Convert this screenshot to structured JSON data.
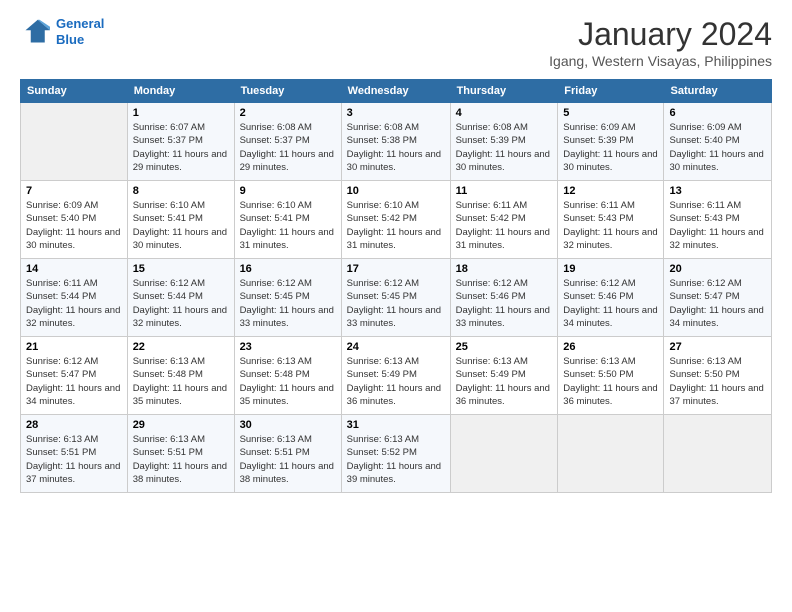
{
  "logo": {
    "line1": "General",
    "line2": "Blue"
  },
  "title": "January 2024",
  "subtitle": "Igang, Western Visayas, Philippines",
  "days_header": [
    "Sunday",
    "Monday",
    "Tuesday",
    "Wednesday",
    "Thursday",
    "Friday",
    "Saturday"
  ],
  "weeks": [
    [
      {
        "num": "",
        "sunrise": "",
        "sunset": "",
        "daylight": ""
      },
      {
        "num": "1",
        "sunrise": "Sunrise: 6:07 AM",
        "sunset": "Sunset: 5:37 PM",
        "daylight": "Daylight: 11 hours and 29 minutes."
      },
      {
        "num": "2",
        "sunrise": "Sunrise: 6:08 AM",
        "sunset": "Sunset: 5:37 PM",
        "daylight": "Daylight: 11 hours and 29 minutes."
      },
      {
        "num": "3",
        "sunrise": "Sunrise: 6:08 AM",
        "sunset": "Sunset: 5:38 PM",
        "daylight": "Daylight: 11 hours and 30 minutes."
      },
      {
        "num": "4",
        "sunrise": "Sunrise: 6:08 AM",
        "sunset": "Sunset: 5:39 PM",
        "daylight": "Daylight: 11 hours and 30 minutes."
      },
      {
        "num": "5",
        "sunrise": "Sunrise: 6:09 AM",
        "sunset": "Sunset: 5:39 PM",
        "daylight": "Daylight: 11 hours and 30 minutes."
      },
      {
        "num": "6",
        "sunrise": "Sunrise: 6:09 AM",
        "sunset": "Sunset: 5:40 PM",
        "daylight": "Daylight: 11 hours and 30 minutes."
      }
    ],
    [
      {
        "num": "7",
        "sunrise": "Sunrise: 6:09 AM",
        "sunset": "Sunset: 5:40 PM",
        "daylight": "Daylight: 11 hours and 30 minutes."
      },
      {
        "num": "8",
        "sunrise": "Sunrise: 6:10 AM",
        "sunset": "Sunset: 5:41 PM",
        "daylight": "Daylight: 11 hours and 30 minutes."
      },
      {
        "num": "9",
        "sunrise": "Sunrise: 6:10 AM",
        "sunset": "Sunset: 5:41 PM",
        "daylight": "Daylight: 11 hours and 31 minutes."
      },
      {
        "num": "10",
        "sunrise": "Sunrise: 6:10 AM",
        "sunset": "Sunset: 5:42 PM",
        "daylight": "Daylight: 11 hours and 31 minutes."
      },
      {
        "num": "11",
        "sunrise": "Sunrise: 6:11 AM",
        "sunset": "Sunset: 5:42 PM",
        "daylight": "Daylight: 11 hours and 31 minutes."
      },
      {
        "num": "12",
        "sunrise": "Sunrise: 6:11 AM",
        "sunset": "Sunset: 5:43 PM",
        "daylight": "Daylight: 11 hours and 32 minutes."
      },
      {
        "num": "13",
        "sunrise": "Sunrise: 6:11 AM",
        "sunset": "Sunset: 5:43 PM",
        "daylight": "Daylight: 11 hours and 32 minutes."
      }
    ],
    [
      {
        "num": "14",
        "sunrise": "Sunrise: 6:11 AM",
        "sunset": "Sunset: 5:44 PM",
        "daylight": "Daylight: 11 hours and 32 minutes."
      },
      {
        "num": "15",
        "sunrise": "Sunrise: 6:12 AM",
        "sunset": "Sunset: 5:44 PM",
        "daylight": "Daylight: 11 hours and 32 minutes."
      },
      {
        "num": "16",
        "sunrise": "Sunrise: 6:12 AM",
        "sunset": "Sunset: 5:45 PM",
        "daylight": "Daylight: 11 hours and 33 minutes."
      },
      {
        "num": "17",
        "sunrise": "Sunrise: 6:12 AM",
        "sunset": "Sunset: 5:45 PM",
        "daylight": "Daylight: 11 hours and 33 minutes."
      },
      {
        "num": "18",
        "sunrise": "Sunrise: 6:12 AM",
        "sunset": "Sunset: 5:46 PM",
        "daylight": "Daylight: 11 hours and 33 minutes."
      },
      {
        "num": "19",
        "sunrise": "Sunrise: 6:12 AM",
        "sunset": "Sunset: 5:46 PM",
        "daylight": "Daylight: 11 hours and 34 minutes."
      },
      {
        "num": "20",
        "sunrise": "Sunrise: 6:12 AM",
        "sunset": "Sunset: 5:47 PM",
        "daylight": "Daylight: 11 hours and 34 minutes."
      }
    ],
    [
      {
        "num": "21",
        "sunrise": "Sunrise: 6:12 AM",
        "sunset": "Sunset: 5:47 PM",
        "daylight": "Daylight: 11 hours and 34 minutes."
      },
      {
        "num": "22",
        "sunrise": "Sunrise: 6:13 AM",
        "sunset": "Sunset: 5:48 PM",
        "daylight": "Daylight: 11 hours and 35 minutes."
      },
      {
        "num": "23",
        "sunrise": "Sunrise: 6:13 AM",
        "sunset": "Sunset: 5:48 PM",
        "daylight": "Daylight: 11 hours and 35 minutes."
      },
      {
        "num": "24",
        "sunrise": "Sunrise: 6:13 AM",
        "sunset": "Sunset: 5:49 PM",
        "daylight": "Daylight: 11 hours and 36 minutes."
      },
      {
        "num": "25",
        "sunrise": "Sunrise: 6:13 AM",
        "sunset": "Sunset: 5:49 PM",
        "daylight": "Daylight: 11 hours and 36 minutes."
      },
      {
        "num": "26",
        "sunrise": "Sunrise: 6:13 AM",
        "sunset": "Sunset: 5:50 PM",
        "daylight": "Daylight: 11 hours and 36 minutes."
      },
      {
        "num": "27",
        "sunrise": "Sunrise: 6:13 AM",
        "sunset": "Sunset: 5:50 PM",
        "daylight": "Daylight: 11 hours and 37 minutes."
      }
    ],
    [
      {
        "num": "28",
        "sunrise": "Sunrise: 6:13 AM",
        "sunset": "Sunset: 5:51 PM",
        "daylight": "Daylight: 11 hours and 37 minutes."
      },
      {
        "num": "29",
        "sunrise": "Sunrise: 6:13 AM",
        "sunset": "Sunset: 5:51 PM",
        "daylight": "Daylight: 11 hours and 38 minutes."
      },
      {
        "num": "30",
        "sunrise": "Sunrise: 6:13 AM",
        "sunset": "Sunset: 5:51 PM",
        "daylight": "Daylight: 11 hours and 38 minutes."
      },
      {
        "num": "31",
        "sunrise": "Sunrise: 6:13 AM",
        "sunset": "Sunset: 5:52 PM",
        "daylight": "Daylight: 11 hours and 39 minutes."
      },
      {
        "num": "",
        "sunrise": "",
        "sunset": "",
        "daylight": ""
      },
      {
        "num": "",
        "sunrise": "",
        "sunset": "",
        "daylight": ""
      },
      {
        "num": "",
        "sunrise": "",
        "sunset": "",
        "daylight": ""
      }
    ]
  ]
}
